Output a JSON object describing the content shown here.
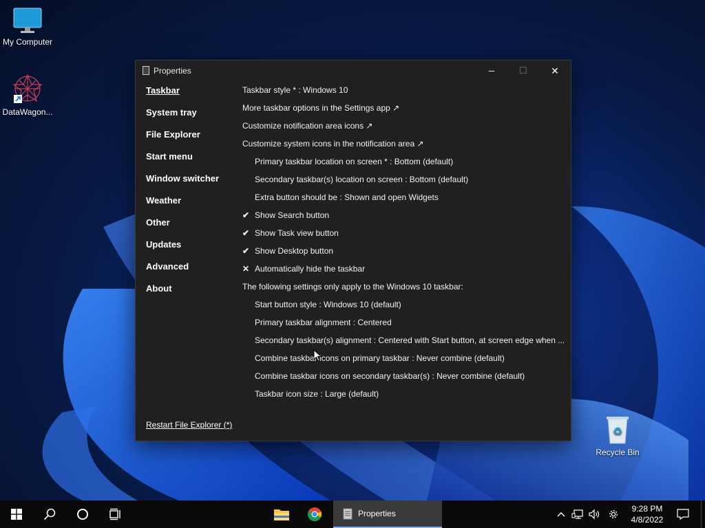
{
  "desktop": {
    "icons": [
      {
        "label": "My Computer"
      },
      {
        "label": "DataWagon..."
      },
      {
        "label": "Recycle Bin"
      }
    ]
  },
  "window": {
    "title": "Properties",
    "controls": {
      "minimize": "─",
      "maximize": "☐",
      "close": "✕"
    },
    "nav": [
      {
        "label": "Taskbar",
        "active": true
      },
      {
        "label": "System tray"
      },
      {
        "label": "File Explorer"
      },
      {
        "label": "Start menu"
      },
      {
        "label": "Window switcher"
      },
      {
        "label": "Weather"
      },
      {
        "label": "Other"
      },
      {
        "label": "Updates"
      },
      {
        "label": "Advanced"
      },
      {
        "label": "About"
      }
    ],
    "restart_link": "Restart File Explorer (*)",
    "settings": [
      {
        "text": "Taskbar style * : Windows 10"
      },
      {
        "text": "More taskbar options in the Settings app ↗"
      },
      {
        "text": "Customize notification area icons ↗"
      },
      {
        "text": "Customize system icons in the notification area ↗"
      },
      {
        "text": "Primary taskbar location on screen * : Bottom (default)"
      },
      {
        "text": "Secondary taskbar(s) location on screen : Bottom (default)"
      },
      {
        "text": "Extra button should be : Shown and open Widgets"
      },
      {
        "text": "Show Search button",
        "mark": "✔"
      },
      {
        "text": "Show Task view button",
        "mark": "✔"
      },
      {
        "text": "Show Desktop button",
        "mark": "✔"
      },
      {
        "text": "Automatically hide the taskbar",
        "mark": "✕"
      },
      {
        "text": "The following settings only apply to the Windows 10 taskbar:"
      },
      {
        "text": "Start button style : Windows 10 (default)"
      },
      {
        "text": "Primary taskbar alignment : Centered"
      },
      {
        "text": "Secondary taskbar(s) alignment : Centered with Start button, at screen edge when ..."
      },
      {
        "text": "Combine taskbar icons on primary taskbar : Never combine (default)"
      },
      {
        "text": "Combine taskbar icons on secondary taskbar(s) : Never combine (default)"
      },
      {
        "text": "Taskbar icon size : Large (default)"
      }
    ]
  },
  "taskbar": {
    "active_app_label": "Properties",
    "clock": {
      "time": "9:28 PM",
      "date": "4/8/2022"
    }
  },
  "colors": {
    "window_bg": "#202020",
    "taskbar_bg": "#0a0a0a",
    "accent": "#7fb3ff",
    "wallpaper_blue": "#1a4fd0"
  }
}
